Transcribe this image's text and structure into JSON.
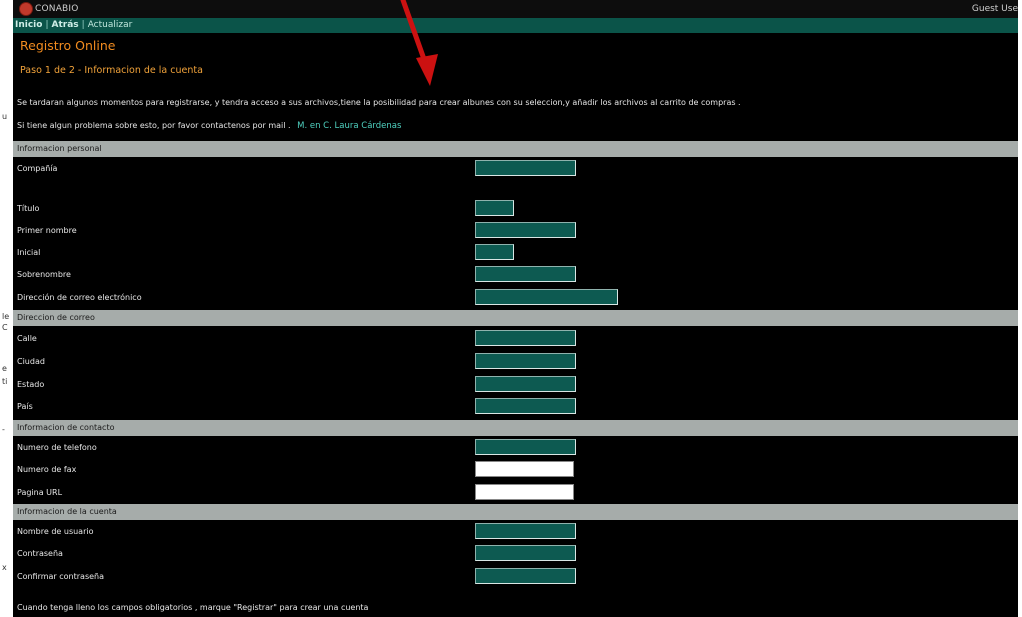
{
  "topbar": {
    "brand": "CONABIO",
    "user": "Guest Use"
  },
  "nav": {
    "home": "Inicio",
    "back": "Atrás",
    "refresh": "Actualizar",
    "sep": "|"
  },
  "page": {
    "title": "Registro Online",
    "step": "Paso 1 de 2 - Informacion de la cuenta",
    "intro": "Se tardaran algunos momentos para registrarse, y tendra acceso a sus archivos,tiene la posibilidad para crear albunes con su seleccion,y añadir los archivos al carrito de compras .",
    "contact_prefix": "Si tiene algun problema sobre esto, por favor contactenos por mail .",
    "contact_name": "M. en C. Laura Cárdenas",
    "footer_note": "Cuando tenga lleno los campos obligatorios , marque \"Registrar\" para crear una cuenta"
  },
  "sections": {
    "personal": "Informacion personal",
    "mailing": "Direccion de correo",
    "contact": "Informacion de contacto",
    "account": "Informacion de la cuenta"
  },
  "fields": {
    "company": "Compañía",
    "title": "Título",
    "first_name": "Primer nombre",
    "initial": "Inicial",
    "last_name": "Sobrenombre",
    "email": "Dirección de correo electrónico",
    "street": "Calle",
    "city": "Ciudad",
    "state": "Estado",
    "country": "País",
    "phone": "Numero de telefono",
    "fax": "Numero de fax",
    "url": "Pagina URL",
    "username": "Nombre de usuario",
    "password": "Contraseña",
    "confirm_password": "Confirmar contraseña"
  },
  "left_strip": [
    "u",
    "C",
    "le",
    "e",
    "ti",
    "-",
    "x"
  ],
  "colors": {
    "accent": "#f28c1f",
    "nav_bg": "#0b5449",
    "input_bg": "#0d5a51",
    "section_bg": "#a6acaa",
    "arrow": "#cc1111"
  }
}
